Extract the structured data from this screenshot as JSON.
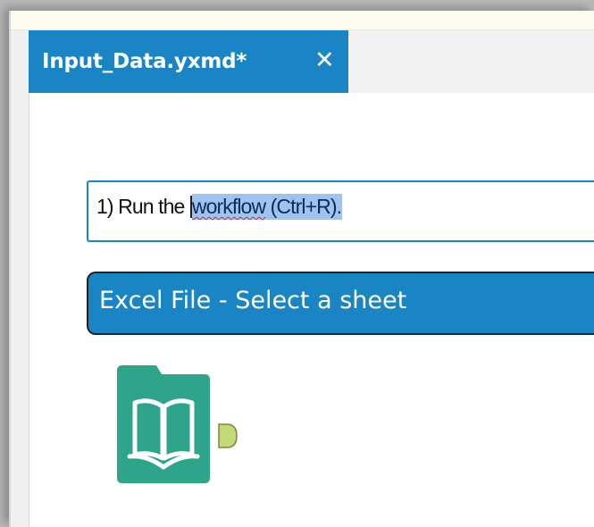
{
  "tab": {
    "title": "Input_Data.yxmd*",
    "close_glyph": "✕"
  },
  "comment": {
    "prefix": "1) Run the ",
    "selected_word": "workflow",
    "selected_rest": " (Ctrl+R)."
  },
  "container": {
    "title": "Excel File - Select a sheet"
  },
  "tool": {
    "icon": "input-data-book-icon",
    "output_anchor_icon": "output-anchor-icon"
  },
  "colors": {
    "accent": "#1a85c5",
    "tool_green": "#2ea58a",
    "anchor_green": "#c3d87a",
    "selection": "#9ec3ee"
  }
}
